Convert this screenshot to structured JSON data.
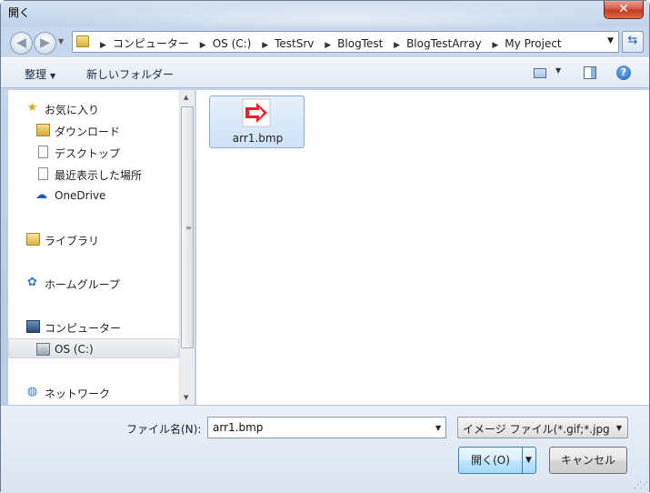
{
  "window": {
    "title": "開く",
    "close_glyph": "✕"
  },
  "address": {
    "back_glyph": "◀",
    "forward_glyph": "▶",
    "breadcrumbs": [
      "コンピューター",
      "OS (C:)",
      "TestSrv",
      "BlogTest",
      "BlogTestArray",
      "My Project"
    ],
    "refresh_glyph": "⇆"
  },
  "toolbar": {
    "organize": "整理",
    "new_folder": "新しいフォルダー",
    "help": "?"
  },
  "navigation": {
    "favorites": "お気に入り",
    "downloads": "ダウンロード",
    "desktop": "デスクトップ",
    "recent": "最近表示した場所",
    "onedrive": "OneDrive",
    "libraries": "ライブラリ",
    "homegroup": "ホームグループ",
    "computer": "コンピューター",
    "os_drive": "OS (C:)",
    "network": "ネットワーク"
  },
  "files": [
    {
      "name": "arr1.bmp",
      "selected": true
    }
  ],
  "bottom": {
    "filename_label": "ファイル名(N):",
    "filename_value": "arr1.bmp",
    "filetype": "イメージ ファイル(*.gif;*.jpg",
    "open_button": "開く(O)",
    "cancel_button": "キャンセル"
  },
  "colors": {
    "accent": "#3c7fb1",
    "arrow_red": "#e8202a",
    "selection": "#cfe2f8"
  }
}
